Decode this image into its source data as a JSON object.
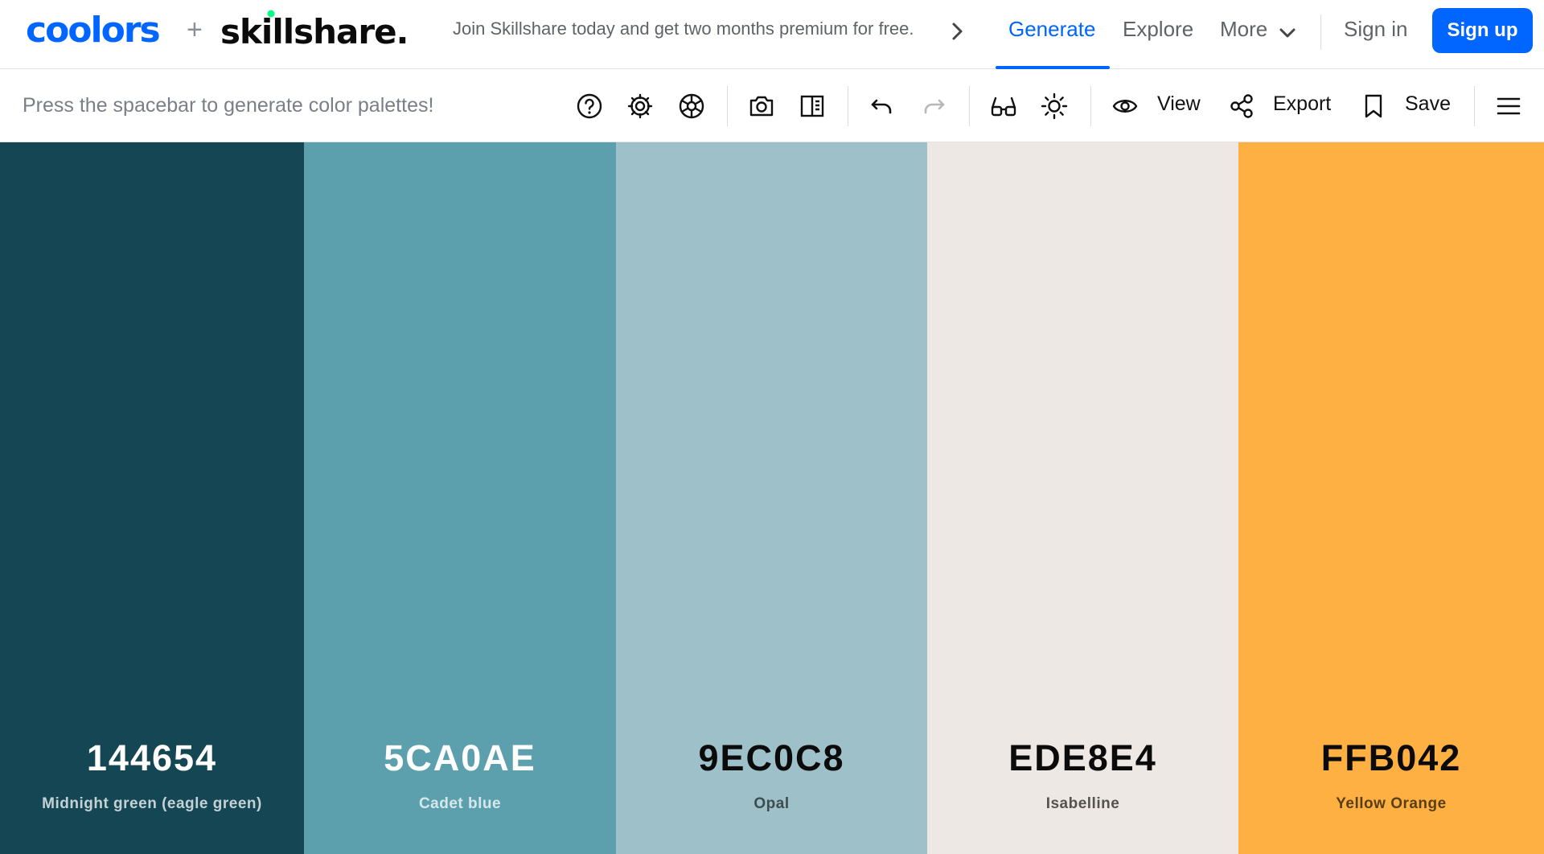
{
  "header": {
    "brand": "coolors",
    "plus": "+",
    "partner": "skillshare.",
    "promo": "Join Skillshare today and get two months premium for free.",
    "nav": {
      "generate": "Generate",
      "explore": "Explore",
      "more": "More",
      "sign_in": "Sign in",
      "sign_up": "Sign up"
    },
    "active_color": "#0066ff"
  },
  "toolbar": {
    "hint": "Press the spacebar to generate color palettes!",
    "view": "View",
    "export": "Export",
    "save": "Save",
    "icons": [
      "help-icon",
      "settings-icon",
      "color-wheel-icon",
      "camera-icon",
      "side-panel-icon",
      "undo-icon",
      "redo-icon",
      "glasses-icon",
      "brightness-icon",
      "eye-icon",
      "share-icon",
      "bookmark-icon",
      "menu-icon"
    ]
  },
  "palette": {
    "colors": [
      {
        "hex": "144654",
        "name": "Midnight green (eagle green)",
        "bg": "#144654",
        "text": "#ffffff",
        "sub": "#c4d1d5"
      },
      {
        "hex": "5CA0AE",
        "name": "Cadet blue",
        "bg": "#5CA0AE",
        "text": "#ffffff",
        "sub": "#d6e8ec"
      },
      {
        "hex": "9EC0C8",
        "name": "Opal",
        "bg": "#9EC0C8",
        "text": "#0b0b0b",
        "sub": "#3f4b4e"
      },
      {
        "hex": "EDE8E4",
        "name": "Isabelline",
        "bg": "#EDE8E4",
        "text": "#0b0b0b",
        "sub": "#55524f"
      },
      {
        "hex": "FFB042",
        "name": "Yellow Orange",
        "bg": "#FFB042",
        "text": "#0b0b0b",
        "sub": "#5b3f14"
      }
    ]
  }
}
